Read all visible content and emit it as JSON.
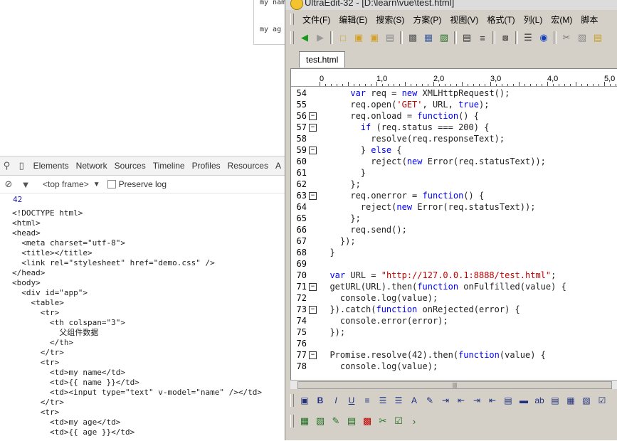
{
  "page_fragment": {
    "row1": "my nam",
    "row2": "my ag"
  },
  "devtools": {
    "tabs": [
      "Elements",
      "Network",
      "Sources",
      "Timeline",
      "Profiles",
      "Resources",
      "A"
    ],
    "frame": "<top frame>",
    "preserve_log": "Preserve log",
    "console_value": "42",
    "code_lines": [
      "<!DOCTYPE html>",
      "<html>",
      "<head>",
      "  <meta charset=\"utf-8\">",
      "  <title></title>",
      "  <link rel=\"stylesheet\" href=\"demo.css\" />",
      "</head>",
      "<body>",
      "  <div id=\"app\">",
      "    <table>",
      "      <tr>",
      "        <th colspan=\"3\">",
      "          父组件数据",
      "        </th>",
      "      </tr>",
      "      <tr>",
      "        <td>my name</td>",
      "        <td>{{ name }}</td>",
      "        <td><input type=\"text\" v-model=\"name\" /></td>",
      "      </tr>",
      "      <tr>",
      "        <td>my age</td>",
      "        <td>{{ age }}</td>"
    ]
  },
  "ultraedit": {
    "title": "UltraEdit-32 - [D:\\learn\\vue\\test.html]",
    "menu": [
      "文件(F)",
      "编辑(E)",
      "搜索(S)",
      "方案(P)",
      "视图(V)",
      "格式(T)",
      "列(L)",
      "宏(M)",
      "脚本"
    ],
    "tab": "test.html",
    "ruler": [
      "0",
      "1,0",
      "2,0",
      "3,0",
      "4,0",
      "5,0"
    ],
    "lines": [
      {
        "n": "54",
        "fold": false,
        "code": "      var req = new XMLHttpRequest();"
      },
      {
        "n": "55",
        "fold": false,
        "code": "      req.open('GET', URL, true);"
      },
      {
        "n": "56",
        "fold": true,
        "code": "      req.onload = function() {"
      },
      {
        "n": "57",
        "fold": true,
        "code": "        if (req.status === 200) {"
      },
      {
        "n": "58",
        "fold": false,
        "code": "          resolve(req.responseText);"
      },
      {
        "n": "59",
        "fold": true,
        "code": "        } else {"
      },
      {
        "n": "60",
        "fold": false,
        "code": "          reject(new Error(req.statusText));"
      },
      {
        "n": "61",
        "fold": false,
        "code": "        }"
      },
      {
        "n": "62",
        "fold": false,
        "code": "      };"
      },
      {
        "n": "63",
        "fold": true,
        "code": "      req.onerror = function() {"
      },
      {
        "n": "64",
        "fold": false,
        "code": "        reject(new Error(req.statusText));"
      },
      {
        "n": "65",
        "fold": false,
        "code": "      };"
      },
      {
        "n": "66",
        "fold": false,
        "code": "      req.send();"
      },
      {
        "n": "67",
        "fold": false,
        "code": "    });"
      },
      {
        "n": "68",
        "fold": false,
        "code": "  }"
      },
      {
        "n": "69",
        "fold": false,
        "code": ""
      },
      {
        "n": "70",
        "fold": false,
        "code": "  var URL = \"http://127.0.0.1:8888/test.html\";"
      },
      {
        "n": "71",
        "fold": true,
        "code": "  getURL(URL).then(function onFulfilled(value) {"
      },
      {
        "n": "72",
        "fold": false,
        "code": "    console.log(value);"
      },
      {
        "n": "73",
        "fold": true,
        "code": "  }).catch(function onRejected(error) {"
      },
      {
        "n": "74",
        "fold": false,
        "code": "    console.error(error);"
      },
      {
        "n": "75",
        "fold": false,
        "code": "  });"
      },
      {
        "n": "76",
        "fold": false,
        "code": ""
      },
      {
        "n": "77",
        "fold": true,
        "code": "  Promise.resolve(42).then(function(value) {"
      },
      {
        "n": "78",
        "fold": false,
        "code": "    console.log(value);"
      }
    ]
  },
  "icons": {
    "toolbar1": [
      "back-icon",
      "forward-icon",
      "new-file-icon",
      "open-icon",
      "open-folder-icon",
      "save-icon",
      "print-icon",
      "print-preview-icon",
      "spell-icon",
      "document-icon",
      "wrap-icon",
      "hex-icon",
      "list-icon",
      "web-icon",
      "cut-icon",
      "copy-icon",
      "paste-icon"
    ],
    "toolbar2": [
      "format-icon",
      "bold-icon",
      "italic-icon",
      "underline-icon",
      "align-icon",
      "bullet-list-icon",
      "numbered-list-icon",
      "font-icon",
      "draw-icon",
      "indent-icon",
      "outdent-icon",
      "indent2-icon",
      "outdent2-icon",
      "form-icon",
      "rule-icon",
      "textfield-icon",
      "table-icon",
      "cell-icon",
      "merge-icon",
      "check-icon"
    ],
    "toolbar3": [
      "grid-icon",
      "copy-page-icon",
      "edit-icon",
      "db-icon",
      "counter-icon",
      "script-icon",
      "validate-icon",
      "more-icon"
    ]
  }
}
